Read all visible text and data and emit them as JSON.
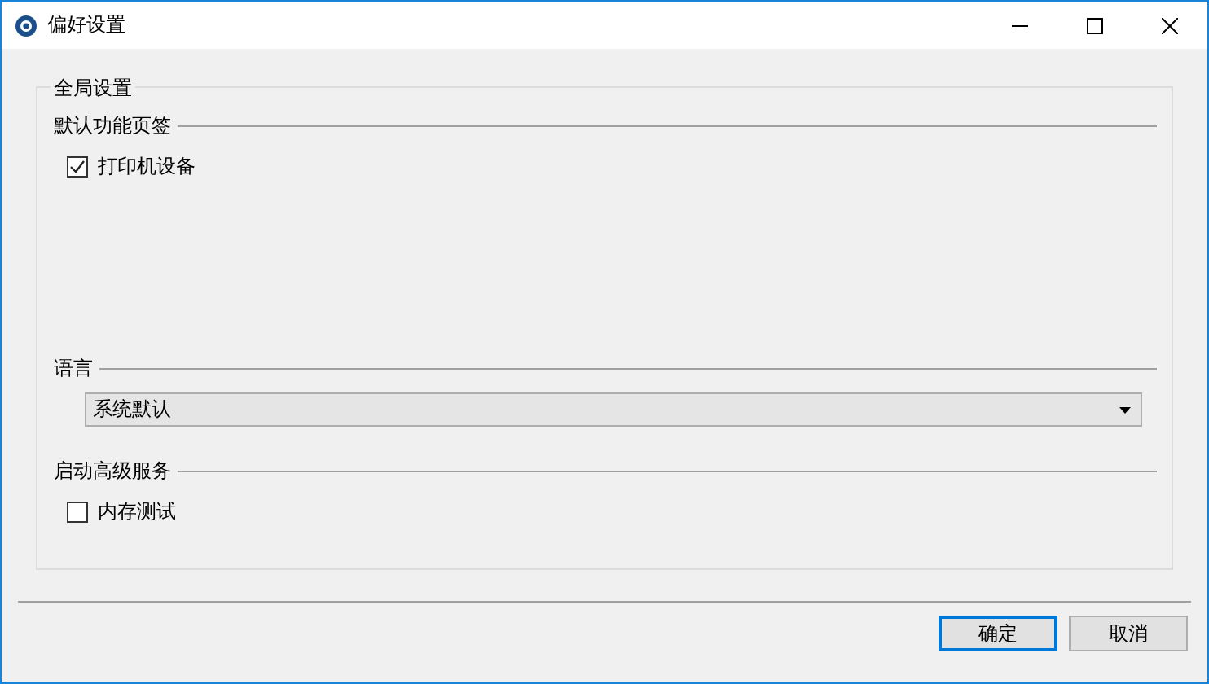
{
  "window": {
    "title": "偏好设置"
  },
  "group": {
    "title": "全局设置",
    "sections": [
      {
        "kind": "checks",
        "title": "默认功能页签",
        "items": [
          {
            "label": "打印机设备",
            "checked": true
          }
        ]
      },
      {
        "kind": "select",
        "title": "语言",
        "value": "系统默认"
      },
      {
        "kind": "checks",
        "title": "启动高级服务",
        "items": [
          {
            "label": "内存测试",
            "checked": false
          }
        ]
      }
    ]
  },
  "buttons": [
    {
      "label": "确定",
      "selected": true
    },
    {
      "label": "取消",
      "selected": false
    }
  ]
}
